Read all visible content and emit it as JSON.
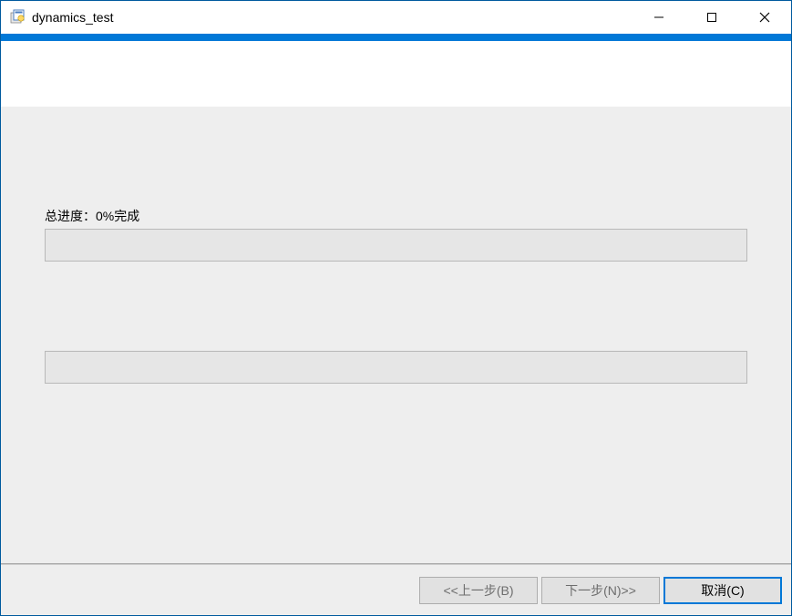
{
  "window": {
    "title": "dynamics_test"
  },
  "content": {
    "progress_label": "总进度：0%完成"
  },
  "footer": {
    "back_label": "<<上一步(B)",
    "next_label": "下一步(N)>>",
    "cancel_label": "取消(C)"
  },
  "watermark": ""
}
